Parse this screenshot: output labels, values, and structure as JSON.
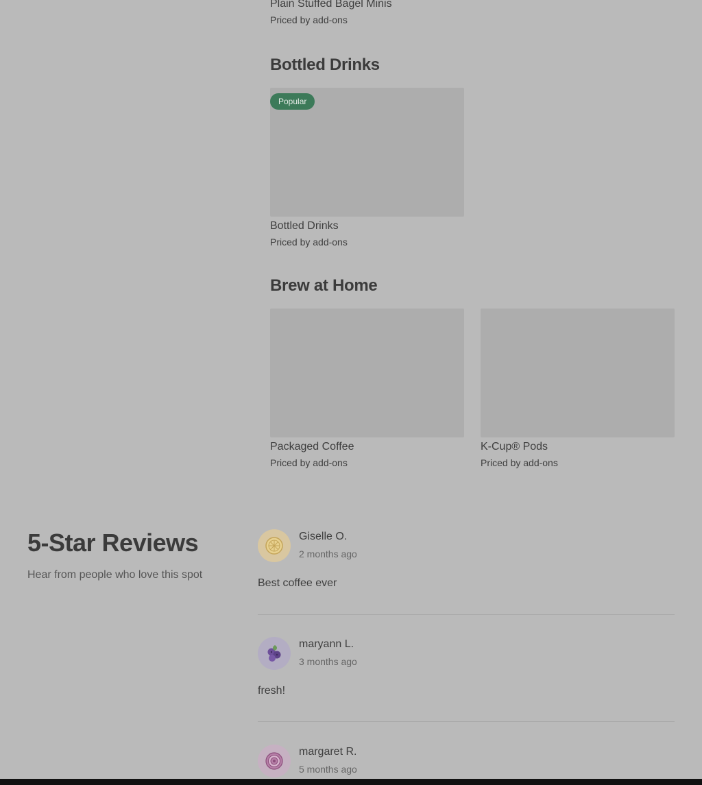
{
  "menu": {
    "partial_item": {
      "title": "Plain Stuffed Bagel Minis",
      "price": "Priced by add-ons"
    },
    "sections": [
      {
        "heading": "Bottled Drinks",
        "items": [
          {
            "badge": "Popular",
            "title": "Bottled Drinks",
            "price": "Priced by add-ons"
          }
        ]
      },
      {
        "heading": "Brew at Home",
        "items": [
          {
            "title": "Packaged Coffee",
            "price": "Priced by add-ons"
          },
          {
            "title": "K-Cup® Pods",
            "price": "Priced by add-ons"
          }
        ]
      }
    ]
  },
  "reviews": {
    "title": "5-Star Reviews",
    "subtitle": "Hear from people who love this spot",
    "items": [
      {
        "name": "Giselle O.",
        "date": "2 months ago",
        "text": "Best coffee ever",
        "avatar_icon": "lemon-icon",
        "avatar_color": "#d9c7a0"
      },
      {
        "name": "maryann L.",
        "date": "3 months ago",
        "text": "fresh!",
        "avatar_icon": "blueberry-icon",
        "avatar_color": "#b3adc3"
      },
      {
        "name": "margaret R.",
        "date": "5 months ago",
        "text": "",
        "avatar_icon": "onion-icon",
        "avatar_color": "#c6b1c2"
      }
    ]
  },
  "colors": {
    "background": "#bababa",
    "badge": "#3c7a59",
    "placeholder_image": "#adadad"
  }
}
